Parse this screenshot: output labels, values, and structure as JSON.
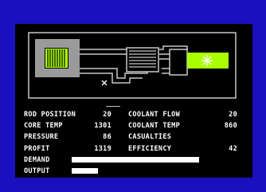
{
  "stats": {
    "rod_position_label": "ROD POSITION",
    "rod_position_value": "20",
    "core_temp_label": "CORE TEMP",
    "core_temp_value": "1301",
    "pressure_label": "PRESSURE",
    "pressure_value": "86",
    "profit_label": "PROFIT",
    "profit_value": "1319",
    "coolant_flow_label": "COOLANT FLOW",
    "coolant_flow_value": "20",
    "coolant_temp_label": "COOLANT TEMP",
    "coolant_temp_value": "860",
    "casualties_label": "CASUALTIES",
    "casualties_value": "",
    "efficiency_label": "EFFICIENCY",
    "efficiency_value": "42"
  },
  "gauges": {
    "demand_label": "DEMAND",
    "demand_level": 0.82,
    "output_label": "OUTPUT",
    "output_level": 0.17
  },
  "colors": {
    "background": "#1a10c0",
    "screen": "#000000",
    "vessel": "#9a9a9a",
    "core": "#aaff00",
    "turbine": "#aaff00",
    "pipe": "#c8c8c8"
  },
  "icons": {
    "valve": "valve-icon",
    "turbine_spark": "spark-icon"
  }
}
